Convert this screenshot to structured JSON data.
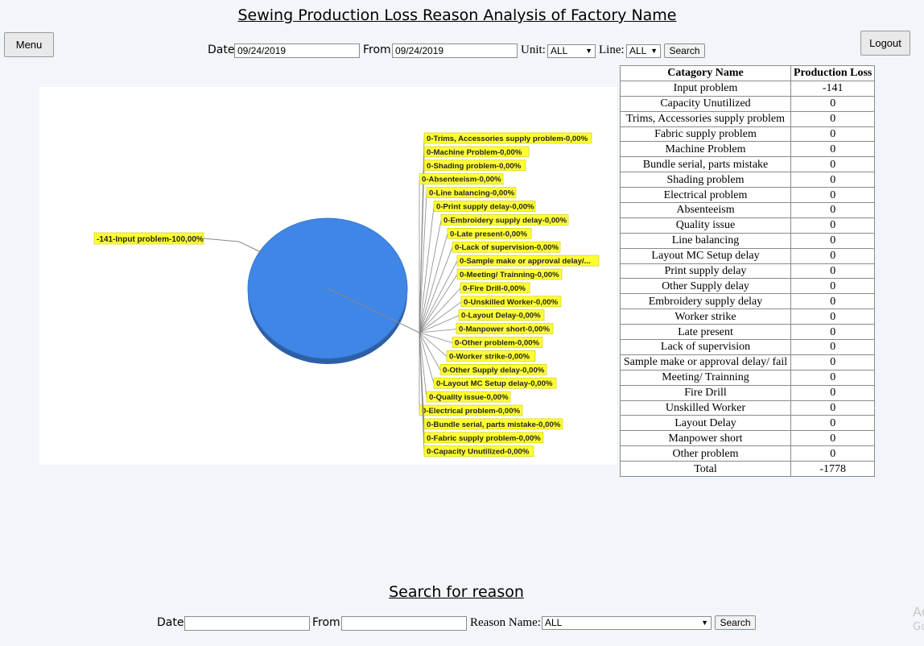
{
  "header": {
    "title": "Sewing Production Loss Reason Analysis of Factory Name"
  },
  "menu_button": "Menu",
  "logout_button": "Logout",
  "filters": {
    "date_label": "Date",
    "date_value": "09/24/2019",
    "from_label": "From",
    "from_value": "09/24/2019",
    "unit_label": "Unit:",
    "unit_value": "ALL",
    "line_label": "Line:",
    "line_value": "ALL",
    "search_label": "Search"
  },
  "chart_data": {
    "type": "pie",
    "slice_color": "#3f86e6",
    "label_bg": "#ffff33",
    "slices": [
      {
        "label": "-141-Input problem-100,00%",
        "value": -141,
        "percent": 100.0
      }
    ],
    "zero_labels": [
      "0-Trims, Accessories supply problem-0,00%",
      "0-Machine Problem-0,00%",
      "0-Shading problem-0,00%",
      "0-Absenteeism-0,00%",
      "0-Line balancing-0,00%",
      "0-Print supply delay-0,00%",
      "0-Embroidery supply delay-0,00%",
      "0-Late present-0,00%",
      "0-Lack of supervision-0,00%",
      "0-Sample make or approval delay/...",
      "0-Meeting/ Trainning-0,00%",
      "0-Fire Drill-0,00%",
      "0-Unskilled Worker-0,00%",
      "0-Layout Delay-0,00%",
      "0-Manpower short-0,00%",
      "0-Other problem-0,00%",
      "0-Worker strike-0,00%",
      "0-Other Supply delay-0,00%",
      "0-Layout MC Setup delay-0,00%",
      "0-Quality issue-0,00%",
      "0-Electrical problem-0,00%",
      "0-Bundle serial, parts mistake-0,00%",
      "0-Fabric supply problem-0,00%",
      "0-Capacity Unutilized-0,00%"
    ]
  },
  "table": {
    "headers": [
      "Catagory Name",
      "Production Loss"
    ],
    "rows": [
      [
        "Input problem",
        "-141"
      ],
      [
        "Capacity Unutilized",
        "0"
      ],
      [
        "Trims, Accessories supply problem",
        "0"
      ],
      [
        "Fabric supply problem",
        "0"
      ],
      [
        "Machine Problem",
        "0"
      ],
      [
        "Bundle serial, parts mistake",
        "0"
      ],
      [
        "Shading problem",
        "0"
      ],
      [
        "Electrical problem",
        "0"
      ],
      [
        "Absenteeism",
        "0"
      ],
      [
        "Quality issue",
        "0"
      ],
      [
        "Line balancing",
        "0"
      ],
      [
        "Layout MC Setup delay",
        "0"
      ],
      [
        "Print supply delay",
        "0"
      ],
      [
        "Other Supply delay",
        "0"
      ],
      [
        "Embroidery supply delay",
        "0"
      ],
      [
        "Worker strike",
        "0"
      ],
      [
        "Late present",
        "0"
      ],
      [
        "Lack of supervision",
        "0"
      ],
      [
        "Sample make or approval delay/ fail",
        "0"
      ],
      [
        "Meeting/ Trainning",
        "0"
      ],
      [
        "Fire Drill",
        "0"
      ],
      [
        "Unskilled Worker",
        "0"
      ],
      [
        "Layout Delay",
        "0"
      ],
      [
        "Manpower short",
        "0"
      ],
      [
        "Other problem",
        "0"
      ]
    ],
    "total_label": "Total",
    "total_value": "-1778"
  },
  "reason_search": {
    "title": "Search for reason",
    "date_label": "Date",
    "date_value": "",
    "from_label": "From",
    "from_value": "",
    "reason_label": "Reason Name:",
    "reason_value": "ALL",
    "search_label": "Search"
  },
  "watermark": {
    "line1": "Ac",
    "line2": "Go"
  }
}
